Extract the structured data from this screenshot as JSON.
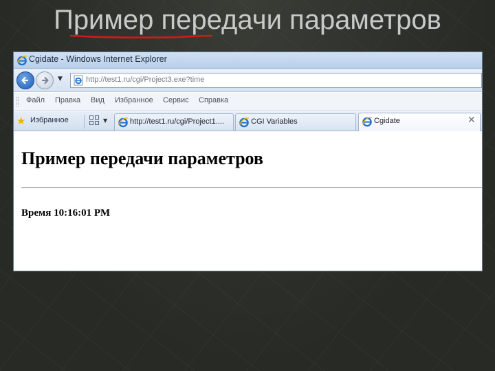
{
  "slide": {
    "title": "Пример передачи параметров"
  },
  "window": {
    "title": "Cgidate - Windows Internet Explorer"
  },
  "address": {
    "url": "http://test1.ru/cgi/Project3.exe?time"
  },
  "menu": {
    "items": [
      "Файл",
      "Правка",
      "Вид",
      "Избранное",
      "Сервис",
      "Справка"
    ]
  },
  "favorites": {
    "label": "Избранное"
  },
  "tabs": [
    {
      "label": "http://test1.ru/cgi/Project1...."
    },
    {
      "label": "CGI Variables"
    },
    {
      "label": "Cgidate"
    }
  ],
  "page": {
    "heading": "Пример передачи параметров",
    "time_text": "Время 10:16:01 PM"
  },
  "colors": {
    "url_underline": "#d11a1a",
    "ie_blue": "#1f6fd1"
  },
  "icons": {
    "back": "back-arrow-icon",
    "forward": "forward-arrow-icon",
    "favorites": "star-icon",
    "close_tab": "close-icon"
  }
}
